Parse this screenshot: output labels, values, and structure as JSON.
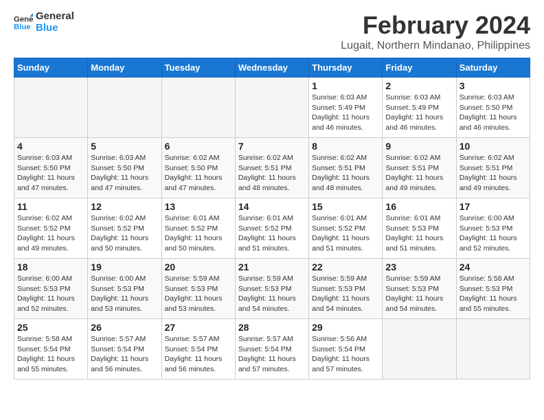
{
  "logo": {
    "line1": "General",
    "line2": "Blue"
  },
  "title": "February 2024",
  "location": "Lugait, Northern Mindanao, Philippines",
  "days_header": [
    "Sunday",
    "Monday",
    "Tuesday",
    "Wednesday",
    "Thursday",
    "Friday",
    "Saturday"
  ],
  "weeks": [
    [
      {
        "day": "",
        "info": ""
      },
      {
        "day": "",
        "info": ""
      },
      {
        "day": "",
        "info": ""
      },
      {
        "day": "",
        "info": ""
      },
      {
        "day": "1",
        "info": "Sunrise: 6:03 AM\nSunset: 5:49 PM\nDaylight: 11 hours\nand 46 minutes."
      },
      {
        "day": "2",
        "info": "Sunrise: 6:03 AM\nSunset: 5:49 PM\nDaylight: 11 hours\nand 46 minutes."
      },
      {
        "day": "3",
        "info": "Sunrise: 6:03 AM\nSunset: 5:50 PM\nDaylight: 11 hours\nand 46 minutes."
      }
    ],
    [
      {
        "day": "4",
        "info": "Sunrise: 6:03 AM\nSunset: 5:50 PM\nDaylight: 11 hours\nand 47 minutes."
      },
      {
        "day": "5",
        "info": "Sunrise: 6:03 AM\nSunset: 5:50 PM\nDaylight: 11 hours\nand 47 minutes."
      },
      {
        "day": "6",
        "info": "Sunrise: 6:02 AM\nSunset: 5:50 PM\nDaylight: 11 hours\nand 47 minutes."
      },
      {
        "day": "7",
        "info": "Sunrise: 6:02 AM\nSunset: 5:51 PM\nDaylight: 11 hours\nand 48 minutes."
      },
      {
        "day": "8",
        "info": "Sunrise: 6:02 AM\nSunset: 5:51 PM\nDaylight: 11 hours\nand 48 minutes."
      },
      {
        "day": "9",
        "info": "Sunrise: 6:02 AM\nSunset: 5:51 PM\nDaylight: 11 hours\nand 49 minutes."
      },
      {
        "day": "10",
        "info": "Sunrise: 6:02 AM\nSunset: 5:51 PM\nDaylight: 11 hours\nand 49 minutes."
      }
    ],
    [
      {
        "day": "11",
        "info": "Sunrise: 6:02 AM\nSunset: 5:52 PM\nDaylight: 11 hours\nand 49 minutes."
      },
      {
        "day": "12",
        "info": "Sunrise: 6:02 AM\nSunset: 5:52 PM\nDaylight: 11 hours\nand 50 minutes."
      },
      {
        "day": "13",
        "info": "Sunrise: 6:01 AM\nSunset: 5:52 PM\nDaylight: 11 hours\nand 50 minutes."
      },
      {
        "day": "14",
        "info": "Sunrise: 6:01 AM\nSunset: 5:52 PM\nDaylight: 11 hours\nand 51 minutes."
      },
      {
        "day": "15",
        "info": "Sunrise: 6:01 AM\nSunset: 5:52 PM\nDaylight: 11 hours\nand 51 minutes."
      },
      {
        "day": "16",
        "info": "Sunrise: 6:01 AM\nSunset: 5:53 PM\nDaylight: 11 hours\nand 51 minutes."
      },
      {
        "day": "17",
        "info": "Sunrise: 6:00 AM\nSunset: 5:53 PM\nDaylight: 11 hours\nand 52 minutes."
      }
    ],
    [
      {
        "day": "18",
        "info": "Sunrise: 6:00 AM\nSunset: 5:53 PM\nDaylight: 11 hours\nand 52 minutes."
      },
      {
        "day": "19",
        "info": "Sunrise: 6:00 AM\nSunset: 5:53 PM\nDaylight: 11 hours\nand 53 minutes."
      },
      {
        "day": "20",
        "info": "Sunrise: 5:59 AM\nSunset: 5:53 PM\nDaylight: 11 hours\nand 53 minutes."
      },
      {
        "day": "21",
        "info": "Sunrise: 5:59 AM\nSunset: 5:53 PM\nDaylight: 11 hours\nand 54 minutes."
      },
      {
        "day": "22",
        "info": "Sunrise: 5:59 AM\nSunset: 5:53 PM\nDaylight: 11 hours\nand 54 minutes."
      },
      {
        "day": "23",
        "info": "Sunrise: 5:59 AM\nSunset: 5:53 PM\nDaylight: 11 hours\nand 54 minutes."
      },
      {
        "day": "24",
        "info": "Sunrise: 5:58 AM\nSunset: 5:53 PM\nDaylight: 11 hours\nand 55 minutes."
      }
    ],
    [
      {
        "day": "25",
        "info": "Sunrise: 5:58 AM\nSunset: 5:54 PM\nDaylight: 11 hours\nand 55 minutes."
      },
      {
        "day": "26",
        "info": "Sunrise: 5:57 AM\nSunset: 5:54 PM\nDaylight: 11 hours\nand 56 minutes."
      },
      {
        "day": "27",
        "info": "Sunrise: 5:57 AM\nSunset: 5:54 PM\nDaylight: 11 hours\nand 56 minutes."
      },
      {
        "day": "28",
        "info": "Sunrise: 5:57 AM\nSunset: 5:54 PM\nDaylight: 11 hours\nand 57 minutes."
      },
      {
        "day": "29",
        "info": "Sunrise: 5:56 AM\nSunset: 5:54 PM\nDaylight: 11 hours\nand 57 minutes."
      },
      {
        "day": "",
        "info": ""
      },
      {
        "day": "",
        "info": ""
      }
    ]
  ]
}
